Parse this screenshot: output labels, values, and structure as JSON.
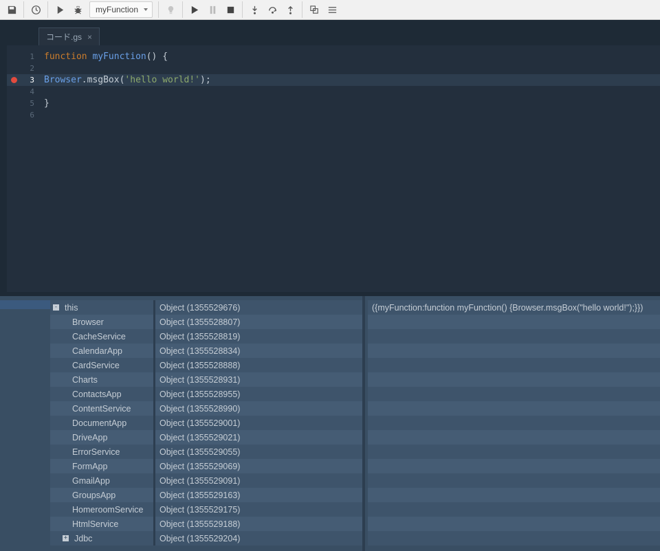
{
  "toolbar": {
    "function_selected": "myFunction"
  },
  "tab": {
    "label": "コード.gs"
  },
  "code": {
    "lines": [
      {
        "n": "1",
        "kw": "function",
        "fn": "myFunction",
        "tail": "() {"
      },
      {
        "n": "2",
        "text": ""
      },
      {
        "n": "3",
        "cls": "Browser",
        "method": ".msgBox(",
        "str": "'hello world!'",
        "tail": ");",
        "bp": true,
        "current": true
      },
      {
        "n": "4",
        "text": ""
      },
      {
        "n": "5",
        "text": "}"
      },
      {
        "n": "6",
        "text": ""
      }
    ]
  },
  "scope": {
    "root": {
      "name": "this",
      "type": "Object (1355529676)",
      "toggle": "-"
    },
    "items": [
      {
        "name": "Browser",
        "type": "Object (1355528807)"
      },
      {
        "name": "CacheService",
        "type": "Object (1355528819)"
      },
      {
        "name": "CalendarApp",
        "type": "Object (1355528834)"
      },
      {
        "name": "CardService",
        "type": "Object (1355528888)"
      },
      {
        "name": "Charts",
        "type": "Object (1355528931)"
      },
      {
        "name": "ContactsApp",
        "type": "Object (1355528955)"
      },
      {
        "name": "ContentService",
        "type": "Object (1355528990)"
      },
      {
        "name": "DocumentApp",
        "type": "Object (1355529001)"
      },
      {
        "name": "DriveApp",
        "type": "Object (1355529021)"
      },
      {
        "name": "ErrorService",
        "type": "Object (1355529055)"
      },
      {
        "name": "FormApp",
        "type": "Object (1355529069)"
      },
      {
        "name": "GmailApp",
        "type": "Object (1355529091)"
      },
      {
        "name": "GroupsApp",
        "type": "Object (1355529163)"
      },
      {
        "name": "HomeroomService",
        "type": "Object (1355529175)"
      },
      {
        "name": "HtmlService",
        "type": "Object (1355529188)"
      },
      {
        "name": "Jdbc",
        "type": "Object (1355529204)",
        "toggle": "+"
      }
    ]
  },
  "value_preview": "({myFunction:function myFunction() {Browser.msgBox(\"hello world!\");}})"
}
